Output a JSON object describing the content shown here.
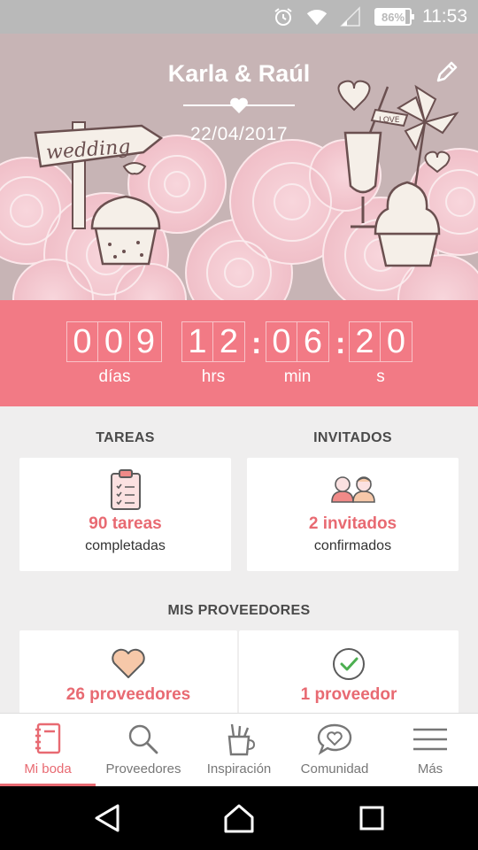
{
  "status_bar": {
    "battery": "86%",
    "battery_level": 0.86,
    "time": "11:53",
    "icons": [
      "alarm-icon",
      "wifi-icon",
      "cell-signal-icon",
      "battery-icon"
    ]
  },
  "hero": {
    "couple": "Karla & Raúl",
    "date": "22/04/2017",
    "sign_text": "wedding",
    "flag_text": "LOVE",
    "edit_icon": "pencil-icon"
  },
  "countdown": {
    "days": [
      "0",
      "0",
      "9"
    ],
    "hours": [
      "1",
      "2"
    ],
    "minutes": [
      "0",
      "6"
    ],
    "seconds": [
      "2",
      "0"
    ],
    "separator": ":",
    "labels": {
      "days": "días",
      "hours": "hrs",
      "minutes": "min",
      "seconds": "s"
    }
  },
  "tasks": {
    "title": "TAREAS",
    "value": "90 tareas",
    "sub": "completadas",
    "icon": "clipboard-checklist-icon"
  },
  "guests": {
    "title": "INVITADOS",
    "value": "2 invitados",
    "sub": "confirmados",
    "icon": "couple-avatars-icon"
  },
  "vendors": {
    "title": "MIS PROVEEDORES",
    "left": {
      "value": "26 proveedores",
      "icon": "heart-icon"
    },
    "right": {
      "value": "1 proveedor",
      "icon": "check-circle-icon"
    }
  },
  "bottom_nav": {
    "items": [
      {
        "label": "Mi boda",
        "icon": "notebook-icon",
        "active": true
      },
      {
        "label": "Proveedores",
        "icon": "search-icon",
        "active": false
      },
      {
        "label": "Inspiración",
        "icon": "brush-cup-icon",
        "active": false
      },
      {
        "label": "Comunidad",
        "icon": "chat-heart-icon",
        "active": false
      },
      {
        "label": "Más",
        "icon": "menu-icon",
        "active": false
      }
    ]
  },
  "system_nav": [
    "back-icon",
    "home-icon",
    "recents-icon"
  ],
  "colors": {
    "accent": "#f27a85",
    "accent_text": "#e86a72",
    "hero_bg": "#c7b4b5",
    "status_bar": "#b9b9b9",
    "page_bg": "#efeeee"
  }
}
